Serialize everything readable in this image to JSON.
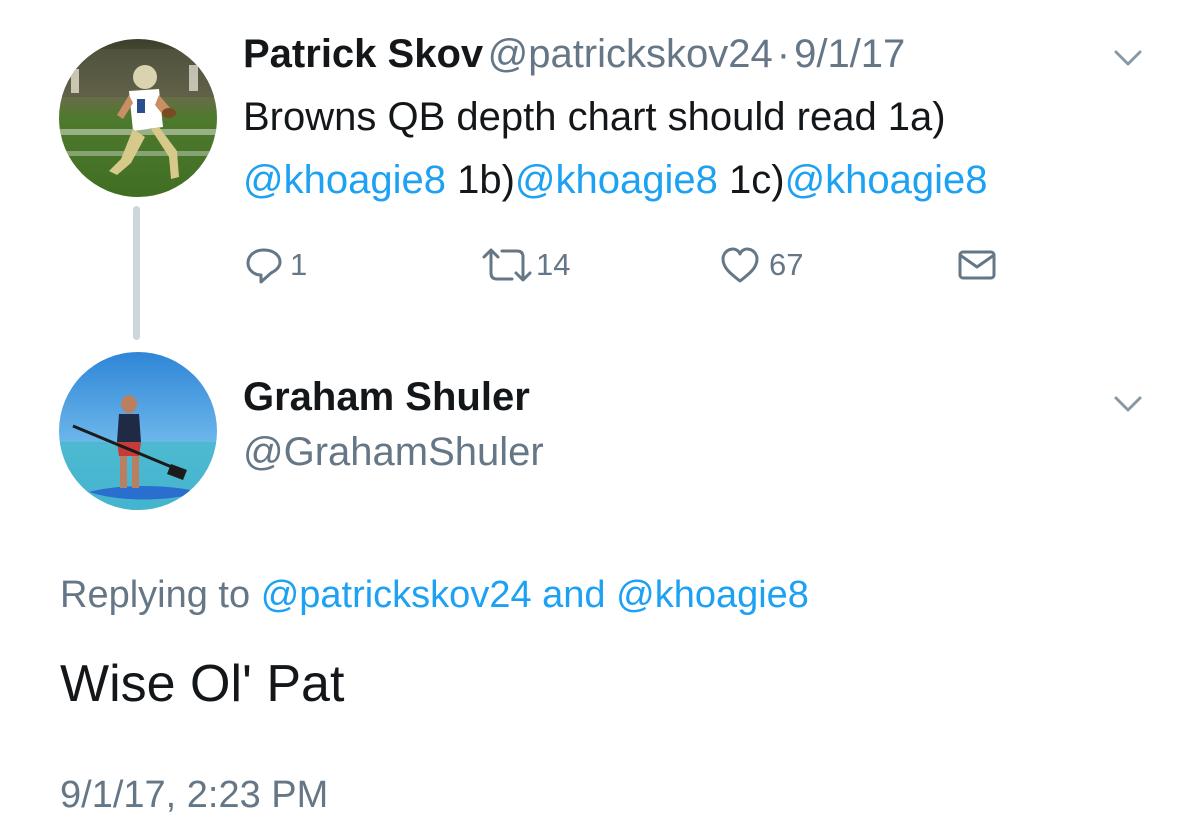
{
  "tweet1": {
    "name": "Patrick Skov",
    "handle": "@patrickskov24",
    "separator": "·",
    "date": "9/1/17",
    "text_line1": "Browns QB depth chart should read 1a)",
    "mention1": "@khoagie8",
    "text_1b": "1b)",
    "mention2": "@khoagie8",
    "text_1c": "1c)",
    "mention3": "@khoagie8",
    "actions": {
      "replies": "1",
      "retweets": "14",
      "likes": "67"
    }
  },
  "tweet2": {
    "name": "Graham Shuler",
    "handle": "@GrahamShuler",
    "replying_prefix": "Replying to",
    "replying_user1": "@patrickskov24",
    "replying_and": "and",
    "replying_user2": "@khoagie8",
    "text": "Wise Ol' Pat",
    "timestamp": "9/1/17, 2:23 PM"
  },
  "colors": {
    "accent": "#1da1f2",
    "secondary_text": "#657786",
    "primary_text": "#14171a",
    "thread_line": "#ccd6dd"
  },
  "icons": {
    "menu": "chevron-down-icon",
    "reply": "reply-icon",
    "retweet": "retweet-icon",
    "like": "heart-icon",
    "dm": "envelope-icon"
  }
}
